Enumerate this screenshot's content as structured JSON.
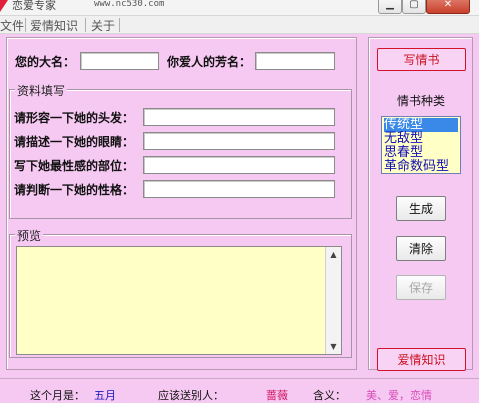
{
  "window": {
    "title": "恋爱专家",
    "url": "www.nc530.com"
  },
  "menu": [
    "文件",
    "爱情知识",
    "关于"
  ],
  "form": {
    "your_name_label": "您的大名：",
    "lover_name_label": "你爱人的芳名：",
    "your_name_value": "",
    "lover_name_value": ""
  },
  "info_group": {
    "title": "资料填写",
    "fields": [
      {
        "label": "请形容一下她的头发：",
        "value": ""
      },
      {
        "label": "请描述一下她的眼睛：",
        "value": ""
      },
      {
        "label": "写下她最性感的部位：",
        "value": ""
      },
      {
        "label": "请判断一下她的性格：",
        "value": ""
      }
    ]
  },
  "preview_group": {
    "title": "预览",
    "content": ""
  },
  "right_panel": {
    "write_button": "写情书",
    "type_label": "情书种类",
    "types": [
      "传统型",
      "无敌型",
      "思春型",
      "革命数码型"
    ],
    "selected_type_index": 0,
    "generate_button": "生成",
    "clear_button": "清除",
    "save_button": "保存",
    "save_enabled": false,
    "knowledge_button": "爱情知识"
  },
  "status_bar": {
    "month_label": "这个月是：",
    "month_value": "五月",
    "gift_label": "应该送别人：",
    "gift_value": "蔷薇",
    "meaning_label": "含义：",
    "meaning_value": "美、爱，恋情"
  },
  "colors": {
    "background": "#f6c9f2",
    "text_area": "#ffffc6",
    "month_value": "#1a18b8",
    "gift_value": "#d01560",
    "meaning_value": "#d84db8",
    "red_button": "#cc1020",
    "selection": "#3a89e8"
  },
  "icons": {
    "app": "app-icon",
    "minimize": "minimize-icon",
    "maximize": "maximize-icon",
    "close": "close-icon",
    "scroll_up": "scroll-up-arrow-icon",
    "scroll_down": "scroll-down-arrow-icon"
  }
}
